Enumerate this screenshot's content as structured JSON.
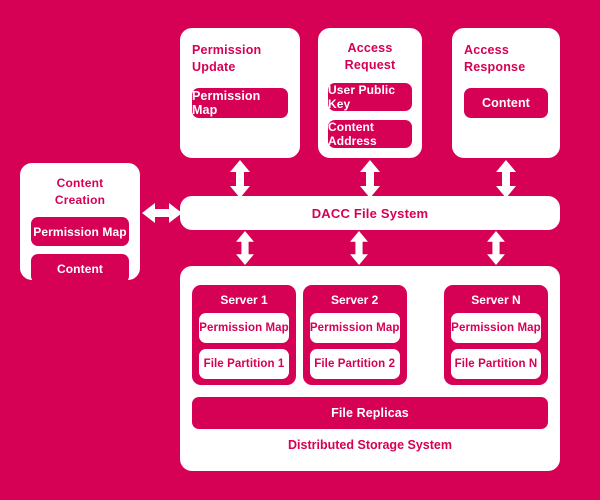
{
  "theme": {
    "background": "#d60055",
    "panel": "#ffffff",
    "accent": "#d60055",
    "text_on_white": "#d60055",
    "text_on_pink": "#ffffff"
  },
  "permission_update": {
    "title_line1": "Permission",
    "title_line2": "Update",
    "items": [
      "Permission Map"
    ]
  },
  "access_request": {
    "title": "Access Request",
    "items": [
      "User Public Key",
      "Content Address"
    ]
  },
  "access_response": {
    "title_line1": "Access",
    "title_line2": "Response",
    "items": [
      "Content"
    ]
  },
  "content_creation": {
    "title": "Content Creation",
    "items": [
      "Permission Map",
      "Content"
    ]
  },
  "dacc": {
    "label": "DACC File System"
  },
  "storage": {
    "label": "Distributed Storage System",
    "replicas_label": "File Replicas",
    "ellipsis": "...",
    "servers": [
      {
        "name": "Server 1",
        "permission_map": "Permission Map",
        "partition": "File Partition 1"
      },
      {
        "name": "Server 2",
        "permission_map": "Permission Map",
        "partition": "File Partition 2"
      },
      {
        "name": "Server N",
        "permission_map": "Permission Map",
        "partition": "File Partition N"
      }
    ]
  },
  "arrows": {
    "h_left": "bidirectional-horizontal-arrow",
    "v_pu_dacc": "bidirectional-vertical-arrow",
    "v_ar_dacc": "bidirectional-vertical-arrow",
    "v_arsp_dacc": "bidirectional-vertical-arrow",
    "v_dacc_s1": "bidirectional-vertical-arrow",
    "v_dacc_s2": "bidirectional-vertical-arrow",
    "v_dacc_sn": "bidirectional-vertical-arrow"
  }
}
